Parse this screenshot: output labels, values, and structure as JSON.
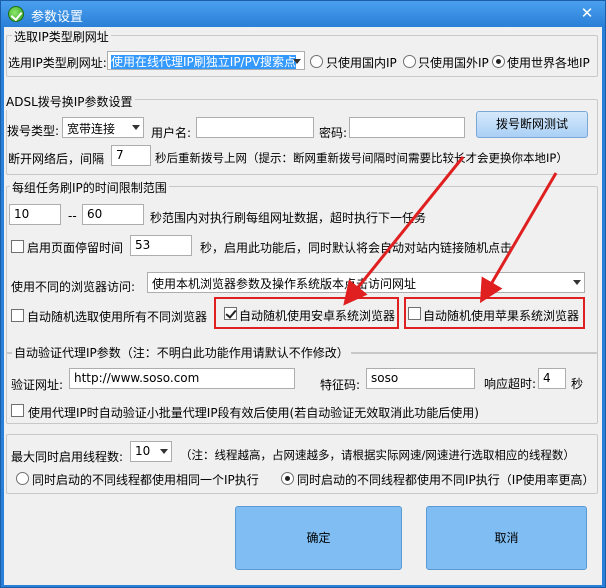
{
  "window": {
    "title": "参数设置",
    "close_glyph": "✕"
  },
  "ip_type": {
    "legend": "选取IP类型刷网址",
    "label": "选用IP类型刷网址:",
    "select_value": "使用在线代理IP刷独立IP/PV搜索点",
    "radio1": "只使用国内IP",
    "radio2": "只使用国外IP",
    "radio3": "使用世界各地IP"
  },
  "adsl": {
    "legend": "ADSL拨号换IP参数设置",
    "dial_type_label": "拨号类型:",
    "dial_type_value": "宽带连接",
    "username_label": "用户名:",
    "username_value": "",
    "password_label": "密码:",
    "password_value": "",
    "test_button": "拨号断网测试",
    "interval_prefix": "断开网络后，间隔",
    "interval_value": "7",
    "interval_suffix": "秒后重新拨号上网（提示：断网重新拨号间隔时间需要比较长才会更换你本地IP）"
  },
  "task_time": {
    "legend": "每组任务刷IP的时间限制范围",
    "min_value": "10",
    "dash": "--",
    "max_value": "60",
    "range_text": "秒范围内对执行刷每组网址数据，超时执行下一任务",
    "stay_label": "启用页面停留时间",
    "stay_value": "53",
    "stay_suffix": "秒，启用此功能后，同时默认将会自动对站内链接随机点击",
    "browser_label": "使用不同的浏览器访问:",
    "browser_value": "使用本机浏览器参数及操作系统版本点击访问网址",
    "random_browser": "自动随机选取使用所有不同浏览器",
    "android": "自动随机使用安卓系统浏览器",
    "ios": "自动随机使用苹果系统浏览器"
  },
  "proxy_verify": {
    "legend": "自动验证代理IP参数（注：不明白此功能作用请默认不作修改）",
    "url_label": "验证网址:",
    "url_value": "http://www.soso.com",
    "code_label": "特征码:",
    "code_value": "soso",
    "timeout_label": "响应超时:",
    "timeout_value": "4",
    "timeout_unit": "秒",
    "small_batch": "使用代理IP时自动验证小批量代理IP段有效后使用(若自动验证无效取消此功能后使用)"
  },
  "threads": {
    "label": "最大同时启用线程数:",
    "value": "10",
    "note": "（注：线程越高，占网速越多，请根据实际网速/网速进行选取相应的线程数）",
    "same_ip": "同时启动的不同线程都使用相同一个IP执行",
    "diff_ip": "同时启动的不同线程都使用不同IP执行（IP使用率更高）"
  },
  "footer": {
    "ok": "确定",
    "cancel": "取消"
  },
  "colors": {
    "accent": "#2a7fd8",
    "highlight": "#e02020",
    "button": "#7fbdf2"
  }
}
